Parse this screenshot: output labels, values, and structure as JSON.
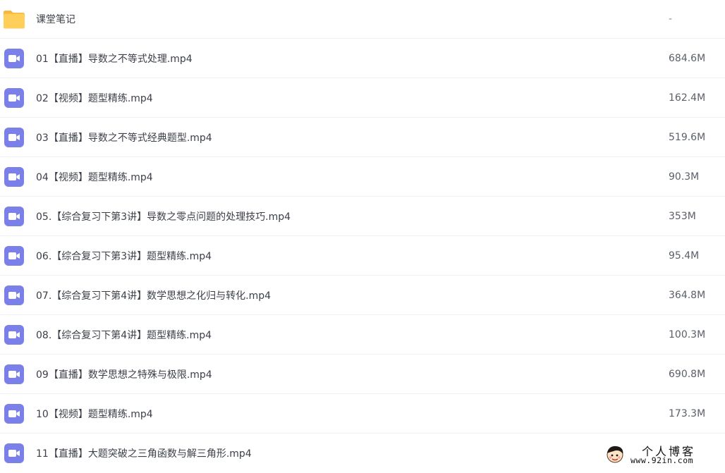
{
  "files": [
    {
      "name": "课堂笔记",
      "size": "-",
      "icon": "folder-icon"
    },
    {
      "name": "01【直播】导数之不等式处理.mp4",
      "size": "684.6M",
      "icon": "video-file-icon"
    },
    {
      "name": "02【视频】题型精练.mp4",
      "size": "162.4M",
      "icon": "video-file-icon"
    },
    {
      "name": "03【直播】导数之不等式经典题型.mp4",
      "size": "519.6M",
      "icon": "video-file-icon"
    },
    {
      "name": "04【视频】题型精练.mp4",
      "size": "90.3M",
      "icon": "video-file-icon"
    },
    {
      "name": "05.【综合复习下第3讲】导数之零点问题的处理技巧.mp4",
      "size": "353M",
      "icon": "video-file-icon"
    },
    {
      "name": "06.【综合复习下第3讲】题型精练.mp4",
      "size": "95.4M",
      "icon": "video-file-icon"
    },
    {
      "name": "07.【综合复习下第4讲】数学思想之化归与转化.mp4",
      "size": "364.8M",
      "icon": "video-file-icon"
    },
    {
      "name": "08.【综合复习下第4讲】题型精练.mp4",
      "size": "100.3M",
      "icon": "video-file-icon"
    },
    {
      "name": "09【直播】数学思想之特殊与极限.mp4",
      "size": "690.8M",
      "icon": "video-file-icon"
    },
    {
      "name": "10【视频】题型精练.mp4",
      "size": "173.3M",
      "icon": "video-file-icon"
    },
    {
      "name": "11【直播】大题突破之三角函数与解三角形.mp4",
      "size": "",
      "icon": "video-file-icon"
    }
  ],
  "watermark": {
    "title": "个人博客",
    "url": "www.92in.com"
  },
  "colors": {
    "folder": "#ffc94d",
    "video": "#7b7fe8",
    "divider": "#eef0f3"
  }
}
